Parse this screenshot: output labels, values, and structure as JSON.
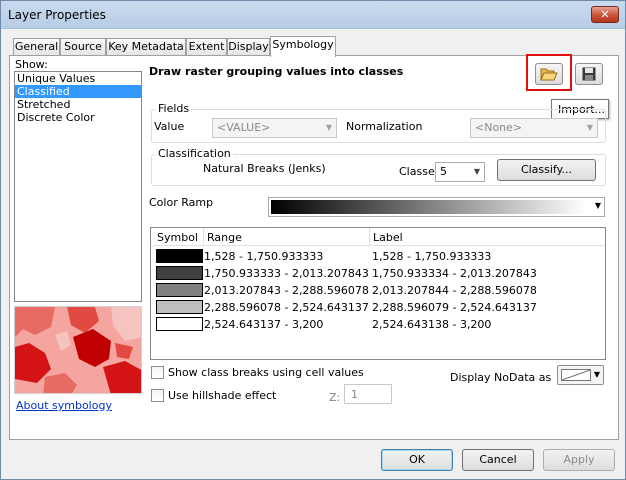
{
  "window": {
    "title": "Layer Properties",
    "close_glyph": "✕"
  },
  "tabs": [
    {
      "label": "General"
    },
    {
      "label": "Source"
    },
    {
      "label": "Key Metadata"
    },
    {
      "label": "Extent"
    },
    {
      "label": "Display"
    },
    {
      "label": "Symbology"
    }
  ],
  "active_tab": "Symbology",
  "show": {
    "label": "Show:",
    "items": [
      {
        "label": "Unique Values"
      },
      {
        "label": "Classified"
      },
      {
        "label": "Stretched"
      },
      {
        "label": "Discrete Color"
      }
    ],
    "selected": "Classified"
  },
  "about_link": "About symbology",
  "heading": "Draw raster grouping values into classes",
  "toolbar": {
    "import_icon": "open-folder-icon",
    "save_icon": "floppy-disk-icon"
  },
  "tooltip": "Import...",
  "fields": {
    "title": "Fields",
    "value_label": "Value",
    "value_selected": "<VALUE>",
    "normalization_label": "Normalization",
    "normalization_selected": "<None>"
  },
  "classification": {
    "title": "Classification",
    "method": "Natural Breaks (Jenks)",
    "classes_label": "Classes",
    "classes_value": "5",
    "classify_button": "Classify..."
  },
  "color_ramp": {
    "label": "Color Ramp",
    "from": "#000000",
    "to": "#ffffff"
  },
  "table": {
    "headers": {
      "symbol": "Symbol",
      "range": "Range",
      "label": "Label"
    },
    "rows": [
      {
        "color": "#000000",
        "range": "1,528 - 1,750.933333",
        "label": "1,528 - 1,750.933333"
      },
      {
        "color": "#404040",
        "range": "1,750.933333 - 2,013.207843",
        "label": "1,750.933334 - 2,013.207843"
      },
      {
        "color": "#808080",
        "range": "2,013.207843 - 2,288.596078",
        "label": "2,013.207844 - 2,288.596078"
      },
      {
        "color": "#bfbfbf",
        "range": "2,288.596078 - 2,524.643137",
        "label": "2,288.596079 - 2,524.643137"
      },
      {
        "color": "#ffffff",
        "range": "2,524.643137 - 3,200",
        "label": "2,524.643138 - 3,200"
      }
    ]
  },
  "options": {
    "show_breaks": "Show class breaks using cell values",
    "hillshade": "Use hillshade effect",
    "z_label": "Z:",
    "z_value": "1",
    "nodata_label": "Display NoData as"
  },
  "buttons": {
    "ok": "OK",
    "cancel": "Cancel",
    "apply": "Apply"
  }
}
